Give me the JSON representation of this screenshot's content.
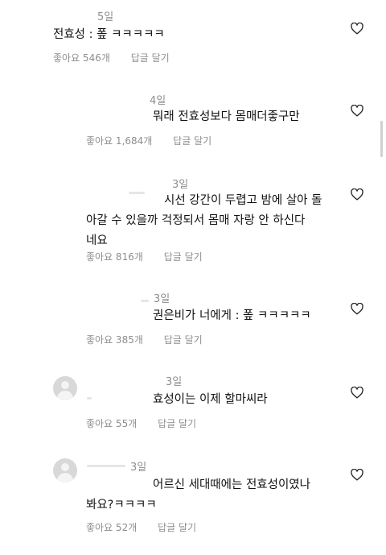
{
  "comments": [
    {
      "time": "5일",
      "text": "전효성 : 퐆 ㅋㅋㅋㅋㅋ",
      "likes": "좋아요 546개",
      "reply": "답글 달기"
    },
    {
      "time": "4일",
      "text": "뭐래 전효성보다 몸매더좋구만",
      "likes": "좋아요 1,684개",
      "reply": "답글 달기"
    },
    {
      "time": "3일",
      "text": "시선 강간이 두렵고 밤에 살아 돌아갈 수 있을까 걱정되서 몸매 자랑 안 하신다네요",
      "line1": "시선 강간이 두렵고 밤에 살아 돌",
      "line2": "아갈 수 있을까 걱정되서 몸매 자랑 안 하신다",
      "line3": "네요",
      "likes": "좋아요 816개",
      "reply": "답글 달기"
    },
    {
      "time": "3일",
      "text": "권은비가 너에게 : 퐆 ㅋㅋㅋㅋㅋ",
      "likes": "좋아요 385개",
      "reply": "답글 달기"
    },
    {
      "time": "3일",
      "text": "효성이는 이제 할마씨라",
      "likes": "좋아요 55개",
      "reply": "답글 달기"
    },
    {
      "time": "3일",
      "line1": "어르신 세대때에는 전효성이였나",
      "line2": "봐요?ㅋㅋㅋㅋ",
      "likes": "좋아요 52개",
      "reply": "답글 달기"
    }
  ],
  "icons": {
    "like": "heart-outline-icon",
    "avatar": "default-avatar-icon"
  },
  "colors": {
    "meta": "#8e8e8e",
    "text": "#111111",
    "scrollbar": "#d0d0d0"
  }
}
